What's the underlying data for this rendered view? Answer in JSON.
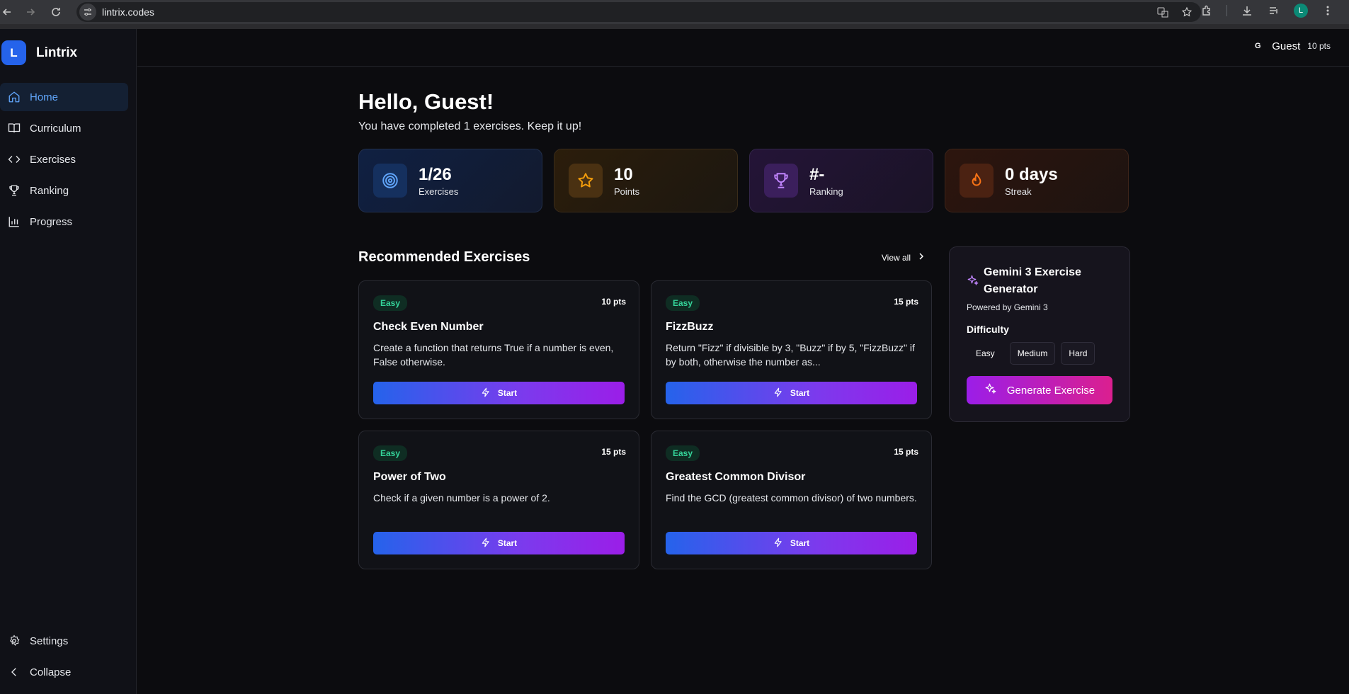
{
  "browser": {
    "url": "lintrix.codes",
    "profile_initial": "L"
  },
  "app": {
    "logo_letter": "L",
    "name": "Lintrix"
  },
  "sidebar": {
    "items": [
      {
        "label": "Home",
        "icon": "home-icon",
        "active": true
      },
      {
        "label": "Curriculum",
        "icon": "book-icon"
      },
      {
        "label": "Exercises",
        "icon": "code-icon"
      },
      {
        "label": "Ranking",
        "icon": "trophy-icon"
      },
      {
        "label": "Progress",
        "icon": "bar-chart-icon"
      }
    ],
    "bottom": [
      {
        "label": "Settings",
        "icon": "gear-icon"
      },
      {
        "label": "Collapse",
        "icon": "chevron-left-icon"
      }
    ]
  },
  "header": {
    "user_initial": "G",
    "user_name": "Guest",
    "user_points": "10 pts"
  },
  "main": {
    "greeting": "Hello, Guest!",
    "subtitle": "You have completed 1 exercises. Keep it up!",
    "stats": [
      {
        "value": "1/26",
        "label": "Exercises",
        "icon": "target-icon",
        "color": "#60a5fa"
      },
      {
        "value": "10",
        "label": "Points",
        "icon": "star-icon",
        "color": "#f59e0b"
      },
      {
        "value": "#-",
        "label": "Ranking",
        "icon": "trophy-icon",
        "color": "#c084fc"
      },
      {
        "value": "0 days",
        "label": "Streak",
        "icon": "flame-icon",
        "color": "#f97316"
      }
    ],
    "recommended_title": "Recommended Exercises",
    "view_all": "View all",
    "exercises": [
      {
        "difficulty": "Easy",
        "points": "10 pts",
        "title": "Check Even Number",
        "description": "Create a function that returns True if a number is even, False otherwise.",
        "button": "Start"
      },
      {
        "difficulty": "Easy",
        "points": "15 pts",
        "title": "FizzBuzz",
        "description": "Return \"Fizz\" if divisible by 3, \"Buzz\" if by 5, \"FizzBuzz\" if by both, otherwise the number as...",
        "button": "Start"
      },
      {
        "difficulty": "Easy",
        "points": "15 pts",
        "title": "Power of Two",
        "description": "Check if a given number is a power of 2.",
        "button": "Start"
      },
      {
        "difficulty": "Easy",
        "points": "15 pts",
        "title": "Greatest Common Divisor",
        "description": "Find the GCD (greatest common divisor) of two numbers.",
        "button": "Start"
      }
    ]
  },
  "generator": {
    "title": "Gemini 3 Exercise Generator",
    "powered_by": "Powered by Gemini 3",
    "difficulty_label": "Difficulty",
    "options": [
      "Easy",
      "Medium",
      "Hard"
    ],
    "selected": "Easy",
    "button": "Generate Exercise"
  }
}
